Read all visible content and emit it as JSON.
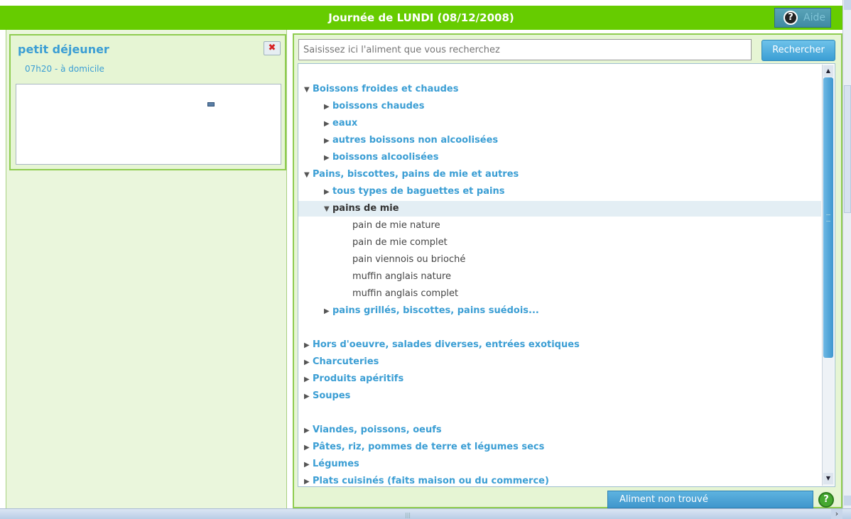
{
  "header": {
    "title": "Journée de LUNDI (08/12/2008)",
    "help_label": "Aide",
    "help_glyph": "?"
  },
  "meal": {
    "title": "petit déjeuner",
    "subtitle": "07h20 - à domicile",
    "delete_glyph": "✖"
  },
  "search": {
    "placeholder": "Saisissez ici l'aliment que vous recherchez",
    "button_label": "Rechercher"
  },
  "tree": [
    {
      "label": "Boissons froides et chaudes",
      "level": "category",
      "expanded": true
    },
    {
      "label": "boissons chaudes",
      "level": "subcategory",
      "expanded": false
    },
    {
      "label": "eaux",
      "level": "subcategory",
      "expanded": false
    },
    {
      "label": "autres boissons non alcoolisées",
      "level": "subcategory",
      "expanded": false
    },
    {
      "label": "boissons alcoolisées",
      "level": "subcategory",
      "expanded": false
    },
    {
      "label": "Pains, biscottes, pains de mie et autres",
      "level": "category",
      "expanded": true
    },
    {
      "label": "tous types de baguettes et pains",
      "level": "subcategory",
      "expanded": false
    },
    {
      "label": "pains de mie",
      "level": "subcategory",
      "expanded": true,
      "selected": true
    },
    {
      "label": "pain de mie nature",
      "level": "item"
    },
    {
      "label": "pain de mie complet",
      "level": "item"
    },
    {
      "label": "pain viennois ou brioché",
      "level": "item"
    },
    {
      "label": "muffin anglais nature",
      "level": "item"
    },
    {
      "label": "muffin anglais complet",
      "level": "item"
    },
    {
      "label": "pains grillés, biscottes, pains suédois...",
      "level": "subcategory",
      "expanded": false
    },
    {
      "label": "Hors d'oeuvre, salades diverses, entrées exotiques",
      "level": "category",
      "expanded": false
    },
    {
      "label": "Charcuteries",
      "level": "category",
      "expanded": false
    },
    {
      "label": "Produits apéritifs",
      "level": "category",
      "expanded": false
    },
    {
      "label": "Soupes",
      "level": "category",
      "expanded": false
    },
    {
      "label": "Viandes, poissons, oeufs",
      "level": "category",
      "expanded": false
    },
    {
      "label": "Pâtes, riz, pommes de terre et légumes secs",
      "level": "category",
      "expanded": false
    },
    {
      "label": "Légumes",
      "level": "category",
      "expanded": false
    },
    {
      "label": "Plats cuisinés (faits maison ou du commerce)",
      "level": "category",
      "expanded": false
    }
  ],
  "footer": {
    "not_found_label": "Aliment non trouvé",
    "help_glyph": "?"
  },
  "icons": {
    "expanded": "▼",
    "collapsed": "▶"
  },
  "colors": {
    "accent_green": "#66cc00",
    "link_blue": "#3b9ed4",
    "panel_bg": "#e6f5d4"
  }
}
